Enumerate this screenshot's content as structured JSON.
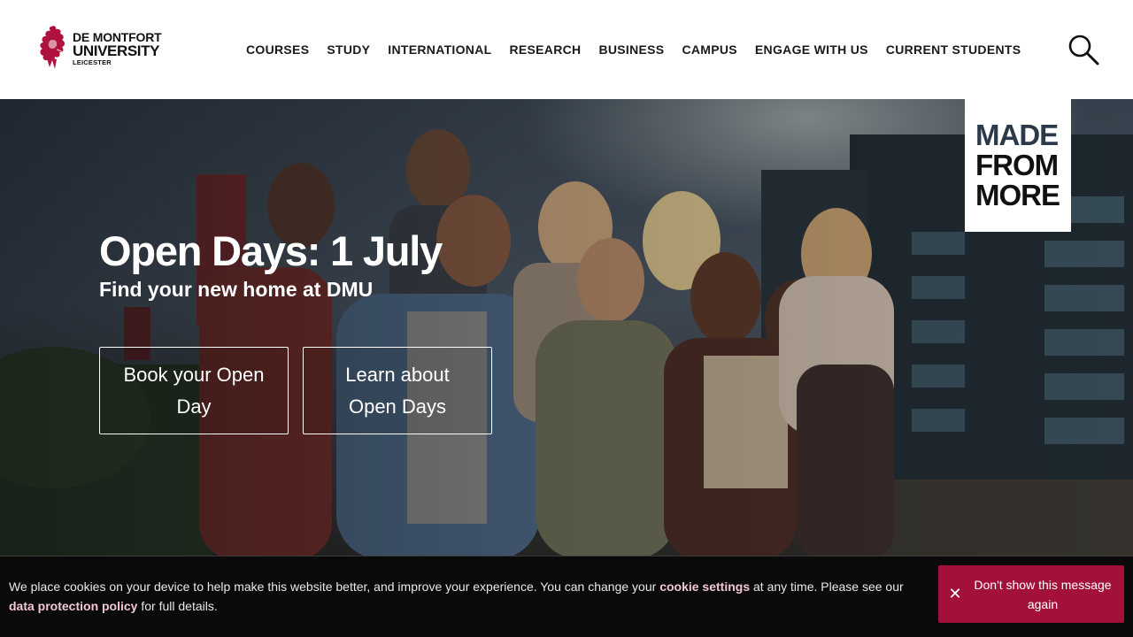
{
  "header": {
    "logo": {
      "line1": "DE MONTFORT",
      "line2": "UNIVERSITY",
      "line3": "LEICESTER",
      "mark_icon": "dmu-lion-icon",
      "color": "#b0123f"
    },
    "nav": [
      {
        "label": "COURSES"
      },
      {
        "label": "STUDY"
      },
      {
        "label": "INTERNATIONAL"
      },
      {
        "label": "RESEARCH"
      },
      {
        "label": "BUSINESS"
      },
      {
        "label": "CAMPUS"
      },
      {
        "label": "ENGAGE WITH US"
      },
      {
        "label": "CURRENT STUDENTS"
      }
    ],
    "search_icon": "search-icon"
  },
  "hero": {
    "badge": {
      "line1": "MADE",
      "line2": "FROM",
      "line3": "MORE"
    },
    "title": "Open Days: 1 July",
    "subtitle": "Find your new home at DMU",
    "buttons": [
      {
        "label": "Book your Open Day"
      },
      {
        "label": "Learn about Open Days"
      }
    ]
  },
  "cookie": {
    "text_before": "We place cookies on your device to help make this website better, and improve your experience. You can change your ",
    "link1": "cookie settings",
    "text_middle": " at any time. Please see our ",
    "link2": "data protection policy",
    "text_after": " for full details.",
    "dismiss_label": "Don't show this message again",
    "dismiss_icon": "close-icon",
    "accent": "#a3113b"
  }
}
